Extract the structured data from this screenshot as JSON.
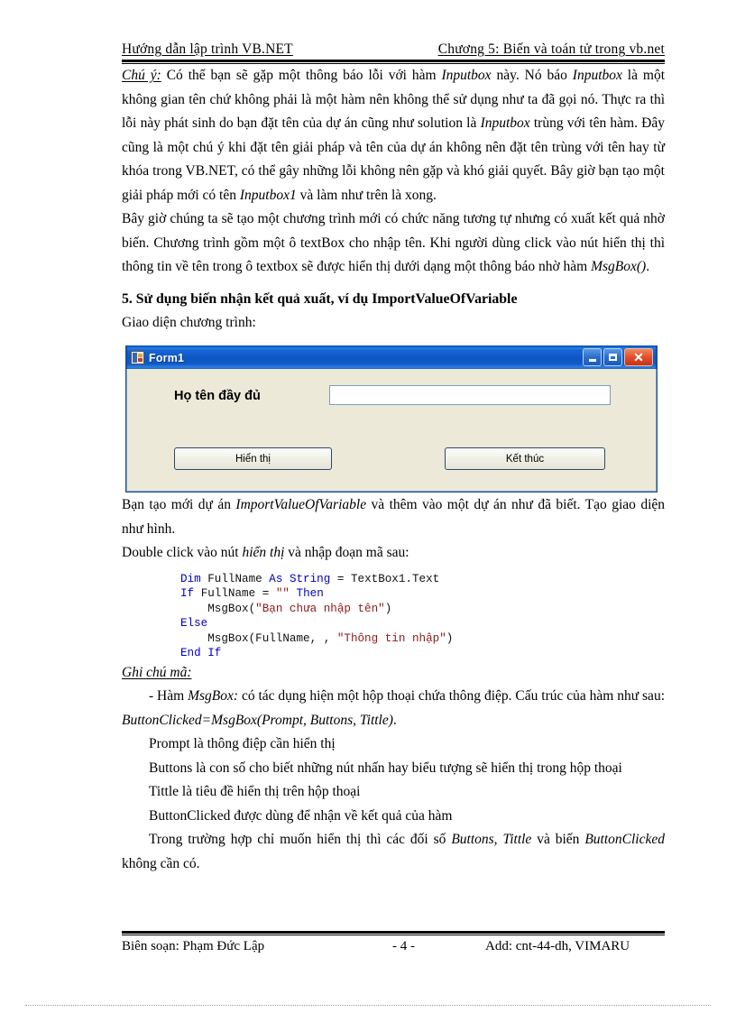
{
  "header": {
    "left": "Hướng dẫn lập trình VB.NET",
    "right": "Chương 5: Biến và toán tử trong vb.net"
  },
  "body": {
    "note_label": "Chú ý:",
    "para_note": " Có thể bạn sẽ gặp một thông báo lỗi với hàm ",
    "note_term1": "Inputbox",
    "note_p2": " này. Nó báo ",
    "note_term2": "Inputbox",
    "note_p3": " là một không gian tên chứ không phải là một hàm nên không thể sử dụng như ta đã gọi nó. Thực ra thì lỗi này phát sinh do bạn đặt tên của dự án cũng như solution là ",
    "note_term3": "Inputbox",
    "note_p4": " trùng với tên hàm. Đây cũng là một chú ý khi đặt tên giải pháp và tên của dự án không nên đặt tên trùng với tên hay từ khóa trong VB.NET, có thể gây những lỗi không nên gặp và khó giải quyết. Bây giờ bạn tạo một giải pháp mới có tên ",
    "note_term4": "Inputbox1",
    "note_p5": " và làm như trên là xong.",
    "para2": "Bây giờ chúng ta sẽ tạo một chương trình mới có chức năng tương tự nhưng có xuất kết quả nhờ biến. Chương trình gồm một ô textBox cho nhập tên. Khi người dùng click vào nút hiển thị thì thông tin về tên trong ô textbox sẽ được hiển thị dưới dạng một thông báo nhờ hàm ",
    "para2_term": "MsgBox()",
    "para2_end": ".",
    "section_title": "5. Sử dụng biến nhận kết quả xuất, ví dụ ImportValueOfVariable",
    "caption_ui": "Giao diện chương trình:",
    "para3_a": "Bạn tạo mới dự án ",
    "para3_term": "ImportValueOfVariable",
    "para3_b": " và thêm vào một dự án như đã biết. Tạo giao diện như hình.",
    "para4_a": "Double click vào nút ",
    "para4_term": "hiển thị",
    "para4_b": " và nhập đoạn mã sau:",
    "note_code_label": "Ghi chú mã:",
    "note_code_a": "- Hàm ",
    "note_code_term": "MsgBox:",
    "note_code_b": " có tác dụng hiện một hộp thoại chứa thông điệp. Cấu trúc của hàm như sau: ",
    "note_code_sig": "ButtonClicked=MsgBox(Prompt, Buttons, Tittle)",
    "note_code_c": ".",
    "bullets": [
      "Prompt là thông điệp cần hiển thị",
      "Buttons là con số cho biết những nút nhấn hay biểu tượng sẽ hiển thị trong hộp thoại",
      "Tittle là tiêu đề hiển thị trên hộp thoại",
      "ButtonClicked được dùng để nhận về kết quả của hàm"
    ],
    "final_a": "Trong trường hợp chỉ muốn hiển thị thì các đối số ",
    "final_term1": "Buttons, Tittle",
    "final_b": " và biến ",
    "final_term2": "ButtonClicked",
    "final_c": " không cần có."
  },
  "form": {
    "title": "Form1",
    "icon": "vb-form-icon",
    "minimize_label": "minimize",
    "maximize_label": "maximize",
    "close_label": "✕",
    "label_fullname": "Họ tên đầy đủ",
    "textbox_value": "",
    "textbox_placeholder": "",
    "button_show": "Hiển thị",
    "button_exit": "Kết thúc",
    "colors": {
      "titlebar_blue": "#0d57c4",
      "form_face": "#ece9d8",
      "close_red": "#e2532c",
      "textbox_border": "#7f9db9"
    }
  },
  "code": {
    "lines": [
      [
        {
          "t": "Dim ",
          "c": "kw"
        },
        {
          "t": "FullName ",
          "c": ""
        },
        {
          "t": "As String ",
          "c": "kw"
        },
        {
          "t": "= TextBox1.Text",
          "c": ""
        }
      ],
      [
        {
          "t": "If ",
          "c": "kw"
        },
        {
          "t": "FullName = ",
          "c": ""
        },
        {
          "t": "\"\" ",
          "c": "str"
        },
        {
          "t": "Then",
          "c": "kw"
        }
      ],
      [
        {
          "t": "    MsgBox(",
          "c": ""
        },
        {
          "t": "\"Bạn chưa nhập tên\"",
          "c": "str"
        },
        {
          "t": ")",
          "c": ""
        }
      ],
      [
        {
          "t": "Else",
          "c": "kw"
        }
      ],
      [
        {
          "t": "    MsgBox(FullName, , ",
          "c": ""
        },
        {
          "t": "\"Thông tin nhập\"",
          "c": "str"
        },
        {
          "t": ")",
          "c": ""
        }
      ],
      [
        {
          "t": "End If",
          "c": "kw"
        }
      ]
    ],
    "colors": {
      "keyword": "#0000c8",
      "string": "#8b1a1a"
    }
  },
  "footer": {
    "left": "Biên soạn: Phạm Đức Lập",
    "center": "- 4 -",
    "right": "Add: cnt-44-dh, VIMARU"
  }
}
